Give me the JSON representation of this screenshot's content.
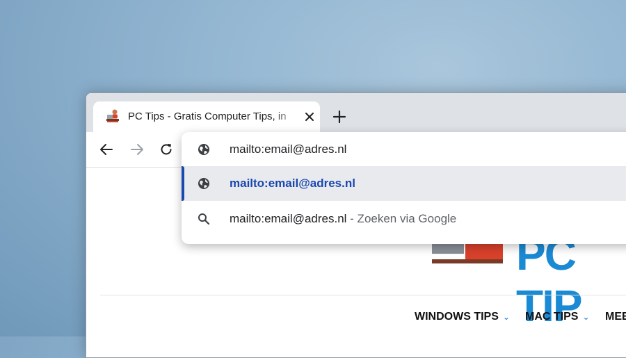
{
  "tab": {
    "title": "PC Tips - Gratis Computer Tips, in"
  },
  "omnibox": {
    "input_value": "mailto:email@adres.nl",
    "suggestions": [
      {
        "icon": "globe-icon",
        "text": "mailto:email@adres.nl"
      },
      {
        "icon": "search-icon",
        "text": "mailto:email@adres.nl",
        "suffix": "- Zoeken via Google"
      }
    ]
  },
  "page": {
    "logo_text": "PC TIP",
    "nav": [
      "WINDOWS TIPS",
      "MAC TIPS",
      "MEE"
    ]
  },
  "colors": {
    "selected_text": "#1a47b0",
    "logo_blue": "#1a8ad4",
    "tabstrip": "#dee1e6"
  }
}
